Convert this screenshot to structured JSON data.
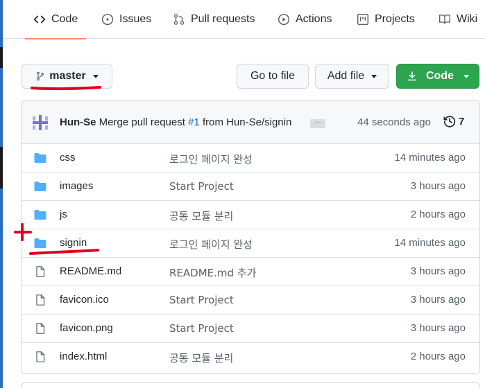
{
  "nav": {
    "tabs": [
      {
        "label": "Code",
        "icon": "code-icon",
        "active": true
      },
      {
        "label": "Issues",
        "icon": "issue-circle-icon"
      },
      {
        "label": "Pull requests",
        "icon": "pull-request-icon"
      },
      {
        "label": "Actions",
        "icon": "play-circle-icon"
      },
      {
        "label": "Projects",
        "icon": "project-board-icon"
      },
      {
        "label": "Wiki",
        "icon": "book-icon"
      }
    ]
  },
  "toolbar": {
    "branch_label": "master",
    "goto_label": "Go to file",
    "addfile_label": "Add file",
    "code_label": "Code"
  },
  "commit": {
    "author": "Hun-Se",
    "message_prefix": "Merge pull request",
    "pr_number": "#1",
    "message_suffix": "from Hun-Se/signin",
    "ellipsis": "…",
    "time": "44 seconds ago",
    "count": "7"
  },
  "files": [
    {
      "name": "css",
      "type": "dir",
      "message": "로그인 페이지 완성",
      "time": "14 minutes ago"
    },
    {
      "name": "images",
      "type": "dir",
      "message": "Start Project",
      "time": "3 hours ago"
    },
    {
      "name": "js",
      "type": "dir",
      "message": "공통 모듈 분리",
      "time": "2 hours ago"
    },
    {
      "name": "signin",
      "type": "dir",
      "message": "로그인 페이지 완성",
      "time": "14 minutes ago"
    },
    {
      "name": "README.md",
      "type": "file",
      "message": "README.md 추가",
      "time": "3 hours ago"
    },
    {
      "name": "favicon.ico",
      "type": "file",
      "message": "Start Project",
      "time": "3 hours ago"
    },
    {
      "name": "favicon.png",
      "type": "file",
      "message": "Start Project",
      "time": "3 hours ago"
    },
    {
      "name": "index.html",
      "type": "file",
      "message": "공통 모듈 분리",
      "time": "2 hours ago"
    }
  ],
  "colors": {
    "accent_blue": "#54aeff",
    "link": "#0969da",
    "green_button": "#2da44e",
    "tab_underline": "#fd8c73",
    "annotation_red": "#e0001b"
  }
}
